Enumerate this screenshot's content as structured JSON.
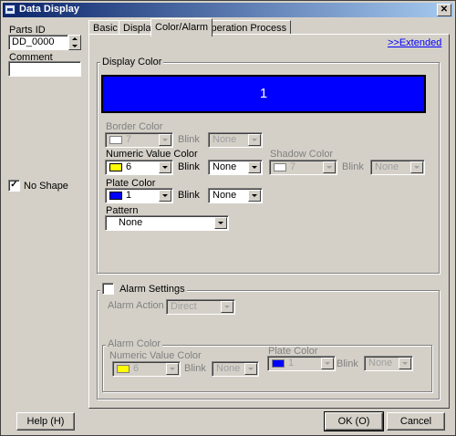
{
  "window": {
    "title": "Data Display",
    "close_glyph": "✕"
  },
  "left": {
    "parts_id_label": "Parts ID",
    "parts_id_value": "DD_0000",
    "comment_label": "Comment",
    "comment_value": "",
    "no_shape_label": "No Shape",
    "no_shape_checked": true,
    "check_glyph": "✓"
  },
  "tabs": [
    {
      "label": "Basic",
      "active": false
    },
    {
      "label": "Display",
      "active": false
    },
    {
      "label": "Color/Alarm",
      "active": true
    },
    {
      "label": "Operation Process",
      "active": false
    }
  ],
  "extended_link": ">>Extended",
  "display_color": {
    "group_label": "Display Color",
    "preview_value": "1",
    "preview_color": "#0000ff",
    "border_color_label": "Border Color",
    "border_color_value": "7",
    "border_color_swatch": "#ffffff",
    "border_blink_label": "Blink",
    "border_blink_value": "None",
    "numeric_value_color_label": "Numeric Value Color",
    "numeric_value_color_value": "6",
    "numeric_value_color_swatch": "#ffff00",
    "numeric_blink_label": "Blink",
    "numeric_blink_value": "None",
    "shadow_color_label": "Shadow Color",
    "shadow_color_value": "7",
    "shadow_color_swatch": "#ffffff",
    "shadow_blink_label": "Blink",
    "shadow_blink_value": "None",
    "plate_color_label": "Plate Color",
    "plate_color_value": "1",
    "plate_color_swatch": "#0000ff",
    "plate_blink_label": "Blink",
    "plate_blink_value": "None",
    "pattern_label": "Pattern",
    "pattern_value": "None"
  },
  "alarm": {
    "settings_label": "Alarm Settings",
    "settings_checked": false,
    "action_label": "Alarm Action",
    "action_value": "Direct",
    "alarm_color_group_label": "Alarm Color",
    "numeric_value_color_label": "Numeric Value Color",
    "numeric_value_color_value": "6",
    "numeric_value_color_swatch": "#ffff00",
    "numeric_blink_label": "Blink",
    "numeric_blink_value": "None",
    "plate_color_label": "Plate Color",
    "plate_color_value": "1",
    "plate_color_swatch": "#0000ff",
    "plate_blink_label": "Blink",
    "plate_blink_value": "None"
  },
  "buttons": {
    "help": "Help (H)",
    "ok": "OK (O)",
    "cancel": "Cancel"
  }
}
